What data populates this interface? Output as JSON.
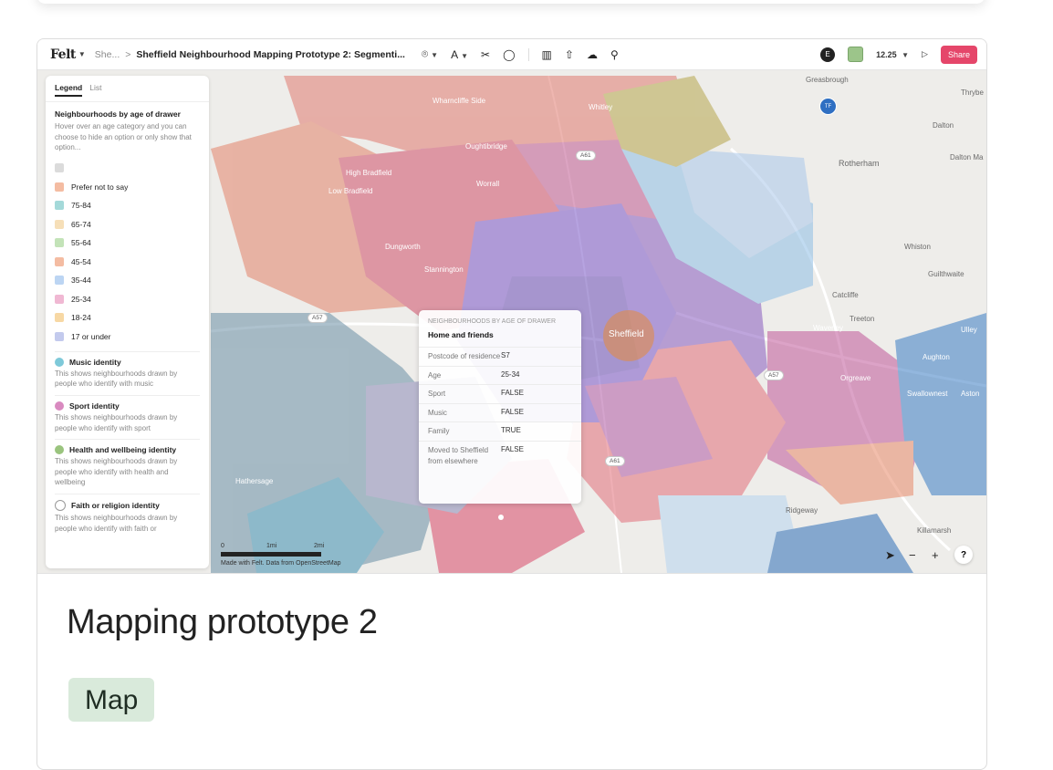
{
  "felt": {
    "logo": "Felt",
    "breadcrumb_dim": "She...",
    "breadcrumb_sep": ">",
    "map_title": "Sheffield Neighbourhood Mapping Prototype 2: Segmenti...",
    "zoom_level": "12.25",
    "share_label": "Share",
    "avatar_letter": "E",
    "icons": [
      "pin-icon",
      "text-icon",
      "scissors-icon",
      "comment-icon",
      "book-icon",
      "upload-icon",
      "cloud-icon",
      "search-icon"
    ]
  },
  "legend": {
    "tab_legend": "Legend",
    "tab_list": "List",
    "heading": "Neighbourhoods by age of drawer",
    "description": "Hover over an age category and you can choose to hide an option or only show that option...",
    "ages": [
      {
        "label": "",
        "color": "#cccccc"
      },
      {
        "label": "Prefer not to say",
        "color": "#f0a07a"
      },
      {
        "label": "75-84",
        "color": "#7ec9c9"
      },
      {
        "label": "65-74",
        "color": "#f2d19a"
      },
      {
        "label": "55-64",
        "color": "#a9d79a"
      },
      {
        "label": "45-54",
        "color": "#f0a07a"
      },
      {
        "label": "35-44",
        "color": "#9fc3ee"
      },
      {
        "label": "25-34",
        "color": "#e99ac0"
      },
      {
        "label": "18-24",
        "color": "#f3c77d"
      },
      {
        "label": "17 or under",
        "color": "#aab4e6"
      }
    ],
    "groups": [
      {
        "title": "Music identity",
        "desc": "This shows neighbourhoods drawn by people who identify with music",
        "color": "#7ec9d9"
      },
      {
        "title": "Sport identity",
        "desc": "This shows neighbourhoods drawn by people who identify with sport",
        "color": "#d98ac0"
      },
      {
        "title": "Health and wellbeing identity",
        "desc": "This shows neighbourhoods drawn by people who identify with health and wellbeing",
        "color": "#9ac47e"
      },
      {
        "title": "Faith or religion identity",
        "desc": "This shows neighbourhoods drawn by people who identify with faith or",
        "color": "#ffffff"
      }
    ]
  },
  "popup": {
    "header": "NEIGHBOURHOODS BY AGE OF DRAWER",
    "title": "Home and friends",
    "rows": [
      {
        "key": "Postcode of residence",
        "value": "S7"
      },
      {
        "key": "Age",
        "value": "25-34"
      },
      {
        "key": "Sport",
        "value": "FALSE"
      },
      {
        "key": "Music",
        "value": "FALSE"
      },
      {
        "key": "Family",
        "value": "TRUE"
      },
      {
        "key": "Moved to Sheffield from elsewhere",
        "value": "FALSE"
      }
    ]
  },
  "map_labels": {
    "greasbrough": "Greasbrough",
    "thrybergh": "Thrybe",
    "wharncliffe": "Wharncliffe Side",
    "whitley": "Whitley",
    "dalton": "Dalton",
    "dalton_ma": "Dalton Ma",
    "oughtibridge": "Oughtibridge",
    "rotherham": "Rotherham",
    "high_bradfield": "High Bradfield",
    "low_bradfield": "Low Bradfield",
    "worrall": "Worrall",
    "whiston": "Whiston",
    "dungworth": "Dungworth",
    "stannington": "Stannington",
    "gulthwaite": "Guilthwaite",
    "catcliffe": "Catcliffe",
    "treeton": "Treeton",
    "waverley": "Waverley",
    "sheffield": "Sheffield",
    "ulley": "Ulley",
    "aughton": "Aughton",
    "orgreave": "Orgreave",
    "swallownest": "Swallownest",
    "aston": "Aston",
    "ridgeway": "Ridgeway",
    "killamarsh": "Killamarsh",
    "hathersage": "Hathersage",
    "road_a57": "A57",
    "road_a61": "A61",
    "badge": "TF"
  },
  "scale": {
    "zero": "0",
    "one": "1mi",
    "two": "2mi",
    "attribution": "Made with Felt. Data from OpenStreetMap"
  },
  "controls": {
    "locate": "➤",
    "minus": "−",
    "plus": "+",
    "help": "?"
  },
  "card": {
    "title": "Mapping prototype 2",
    "tag": "Map"
  }
}
